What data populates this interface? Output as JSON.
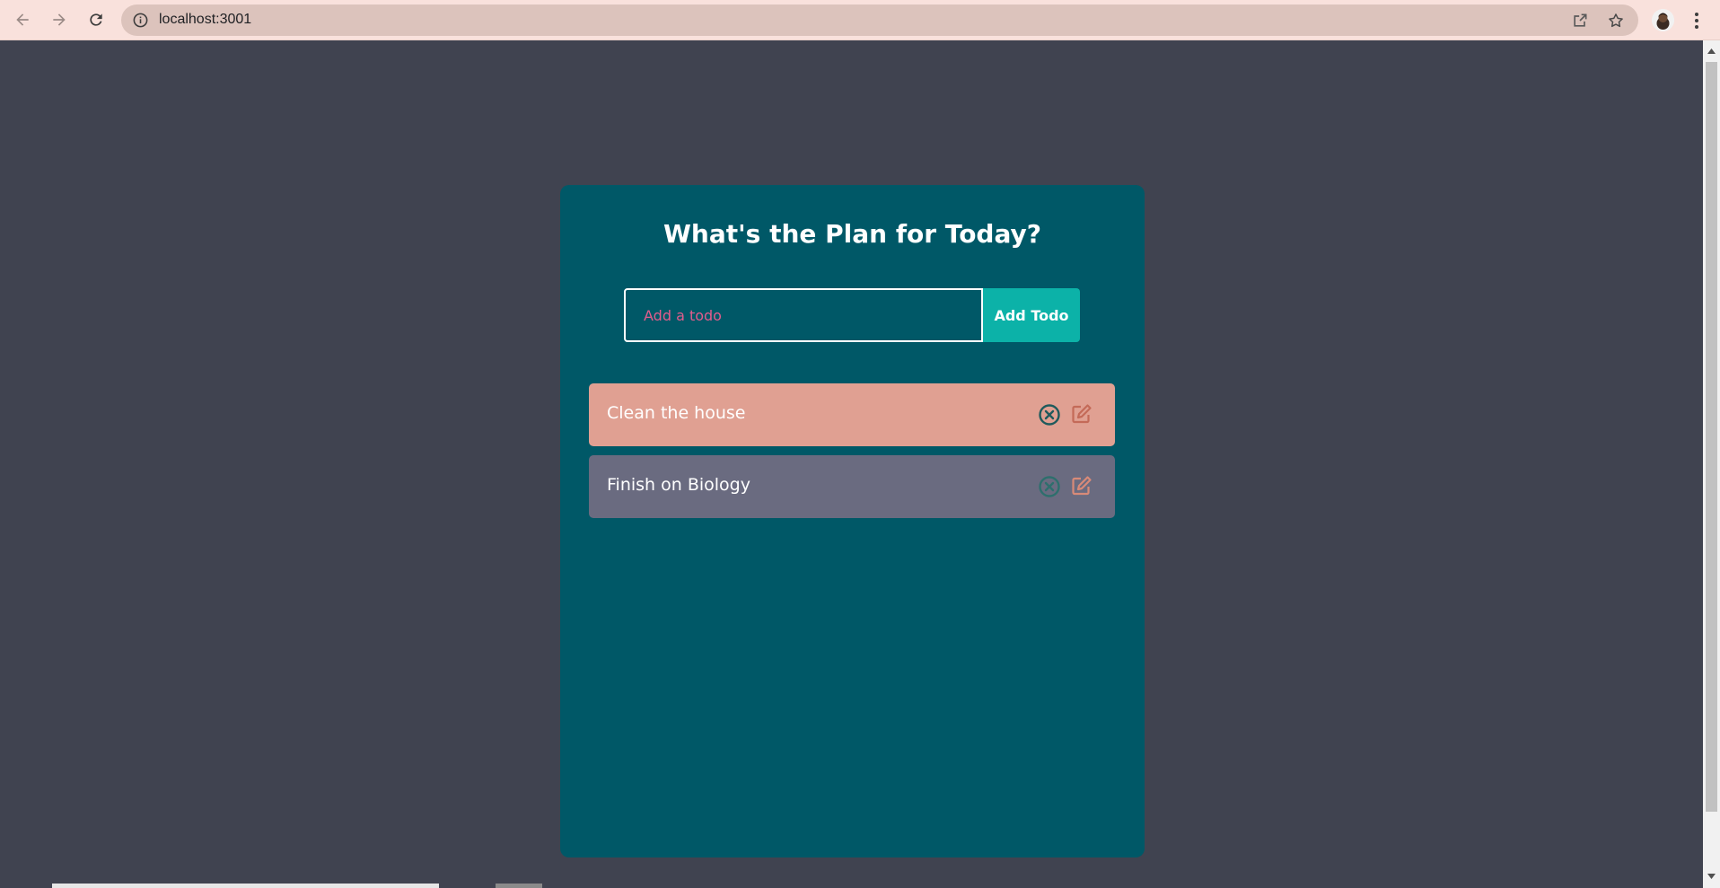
{
  "browser": {
    "url": "localhost:3001",
    "back_icon": "arrow-left-icon",
    "forward_icon": "arrow-right-icon",
    "reload_icon": "reload-icon",
    "info_icon": "info-icon",
    "share_icon": "share-icon",
    "bookmark_icon": "star-icon",
    "menu_icon": "kebab-menu-icon"
  },
  "app": {
    "title": "What's the Plan for Today?",
    "input_placeholder": "Add a todo",
    "input_value": "",
    "add_button_label": "Add Todo",
    "todos": [
      {
        "text": "Clean the house",
        "color": "#e0a092"
      },
      {
        "text": "Finish on Biology",
        "color": "#6a6b80"
      }
    ]
  },
  "colors": {
    "page_bg": "#404350",
    "panel_bg": "#005867",
    "button_bg": "#0cb2a8",
    "placeholder": "#e25c8c",
    "delete_icon": "#2e6f6d",
    "edit_icon": "#d88a78",
    "chrome_bg": "#f9e1dc"
  }
}
